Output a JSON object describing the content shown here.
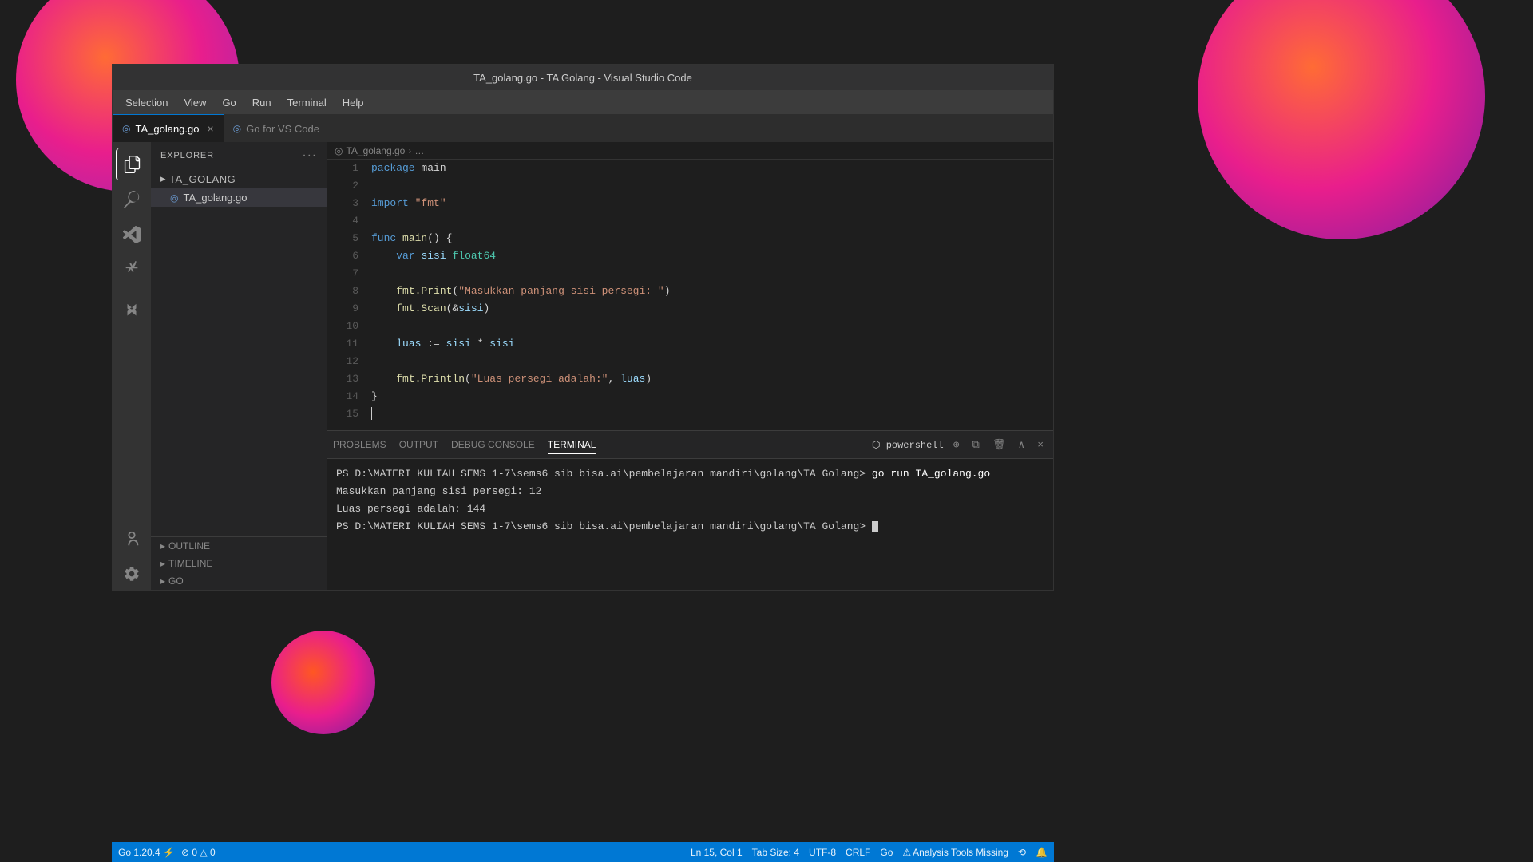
{
  "window": {
    "title": "TA_golang.go - TA Golang - Visual Studio Code"
  },
  "menu": {
    "items": [
      "Selection",
      "View",
      "Go",
      "Run",
      "Terminal",
      "Help"
    ]
  },
  "tabs": [
    {
      "id": "ta-golang",
      "label": "TA_golang.go",
      "active": true,
      "icon": "◎",
      "closable": true
    },
    {
      "id": "go-vscode",
      "label": "Go for VS Code",
      "active": false,
      "icon": "◎",
      "closable": false
    }
  ],
  "breadcrumb": {
    "parts": [
      "TA_golang.go",
      "…"
    ]
  },
  "sidebar": {
    "header": "EXPLORER",
    "folder": "TA_GOLANG",
    "file": "TA_golang.go",
    "bottom_sections": [
      "OUTLINE",
      "TIMELINE",
      "GO"
    ]
  },
  "code": {
    "lines": [
      {
        "num": 1,
        "content": "package main"
      },
      {
        "num": 2,
        "content": ""
      },
      {
        "num": 3,
        "content": "import \"fmt\""
      },
      {
        "num": 4,
        "content": ""
      },
      {
        "num": 5,
        "content": "func main() {"
      },
      {
        "num": 6,
        "content": "    var sisi float64"
      },
      {
        "num": 7,
        "content": ""
      },
      {
        "num": 8,
        "content": "    fmt.Print(\"Masukkan panjang sisi persegi: \")"
      },
      {
        "num": 9,
        "content": "    fmt.Scan(&sisi)"
      },
      {
        "num": 10,
        "content": ""
      },
      {
        "num": 11,
        "content": "    luas := sisi * sisi"
      },
      {
        "num": 12,
        "content": ""
      },
      {
        "num": 13,
        "content": "    fmt.Println(\"Luas persegi adalah:\", luas)"
      },
      {
        "num": 14,
        "content": "}"
      },
      {
        "num": 15,
        "content": ""
      }
    ]
  },
  "terminal": {
    "tabs": [
      "PROBLEMS",
      "OUTPUT",
      "DEBUG CONSOLE",
      "TERMINAL"
    ],
    "active_tab": "TERMINAL",
    "shell": "powershell",
    "lines": [
      "PS D:\\MATERI KULIAH SEMS 1-7\\sems6 sib bisa.ai\\pembelajaran mandiri\\golang\\TA Golang> go run TA_golang.go",
      "Masukkan panjang sisi persegi: 12",
      "Luas persegi adalah: 144",
      "PS D:\\MATERI KULIAH SEMS 1-7\\sems6 sib bisa.ai\\pembelajaran mandiri\\golang\\TA Golang> "
    ]
  },
  "status_bar": {
    "left": {
      "go_version": "Go 1.20.4",
      "errors": "0",
      "warnings": "0"
    },
    "right": {
      "position": "Ln 15, Col 1",
      "tab_size": "Tab Size: 4",
      "encoding": "UTF-8",
      "line_ending": "CRLF",
      "language": "Go",
      "warning": "⚠ Analysis Tools Missing"
    }
  },
  "icons": {
    "explorer": "☰",
    "search": "🔍",
    "git": "⎇",
    "extensions": "⊞",
    "test": "⚗",
    "account": "👤",
    "settings": "⚙",
    "close": "×",
    "chevron_right": "›",
    "arrow_right": "▸",
    "folder": "▸"
  },
  "colors": {
    "accent": "#0078d4",
    "sidebar_bg": "#252526",
    "editor_bg": "#1e1e1e",
    "terminal_bg": "#1e1e1e",
    "status_bar": "#0078d4",
    "tab_active": "#1e1e1e",
    "tab_inactive": "#2d2d2d",
    "keyword": "#569cd6",
    "string": "#ce9178",
    "function": "#dcdcaa",
    "type": "#4ec9b0",
    "variable": "#9cdcfe",
    "comment": "#6a9955"
  }
}
